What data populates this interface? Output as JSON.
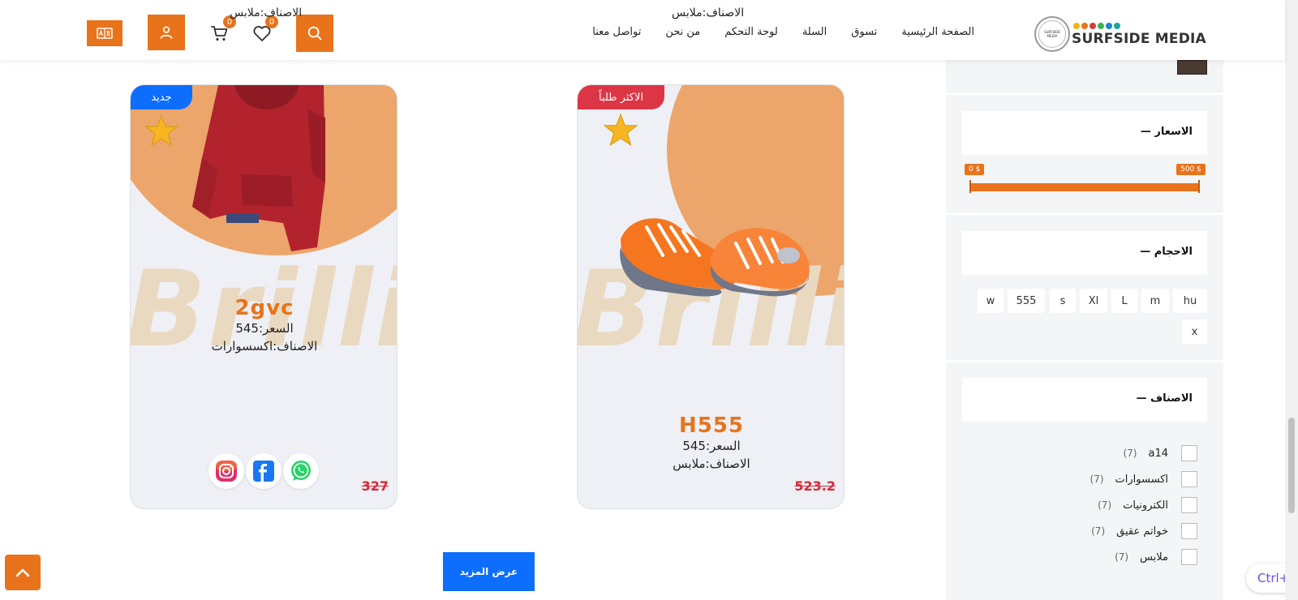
{
  "header": {
    "logo_text": "SURFSIDE MEDIA",
    "logo_circle_text": "SURFSIDE MEDIA",
    "category_caption": "الاصناف:ملابس",
    "overlap_caption": "الاصناف:ملابس",
    "nav": [
      "الصفحة الرئيسية",
      "تسوق",
      "السلة",
      "لوحة التحكم",
      "من نحن",
      "تواصل معنا"
    ],
    "wishlist_count": "0",
    "cart_count": "0",
    "lang_icon": "translate-icon",
    "user_icon": "user-icon",
    "search_icon": "search-icon"
  },
  "sidebar": {
    "prices_title": "الاسعار —",
    "price_min": "0 $",
    "price_max": "500 $",
    "price_range_fraction": [
      0,
      1
    ],
    "sizes_title": "الاحجام —",
    "sizes": [
      "hu",
      "m",
      "L",
      "Xl",
      "s",
      "555",
      "w",
      "x"
    ],
    "categories_title": "الاصناف —",
    "categories": [
      {
        "label": "a14",
        "count": "(7)"
      },
      {
        "label": "اكسسوارات",
        "count": "(7)"
      },
      {
        "label": "الكترونيات",
        "count": "(7)"
      },
      {
        "label": "خواتم عقيق",
        "count": "(7)"
      },
      {
        "label": "ملابس",
        "count": "(7)"
      }
    ]
  },
  "products": [
    {
      "tag": "جديد",
      "name": "2gvc",
      "price_line": "السعر:545",
      "category_line": "الاصناف:اكسسوارات",
      "old_price": "327",
      "watermark": "Brilli"
    },
    {
      "tag": "الاكثر طلباً",
      "name": "H555",
      "price_line": "السعر:545",
      "category_line": "الاصناف:ملابس",
      "old_price": "523.2",
      "watermark": "Brilli"
    }
  ],
  "actions": {
    "show_more": "عرض المزيد",
    "ctrl_hint": "Ctrl+"
  },
  "colors": {
    "accent": "#e8731b",
    "primary_blue": "#0d6efd",
    "best_seller_red": "#dc3545"
  }
}
